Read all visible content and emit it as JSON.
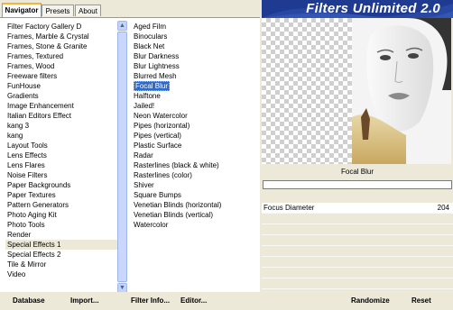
{
  "tabs": [
    {
      "label": "Navigator",
      "active": true
    },
    {
      "label": "Presets",
      "active": false
    },
    {
      "label": "About",
      "active": false
    }
  ],
  "header": {
    "title": "Filters Unlimited 2.0"
  },
  "categories": [
    "Filter Factory Gallery D",
    "Frames, Marble & Crystal",
    "Frames, Stone & Granite",
    "Frames, Textured",
    "Frames, Wood",
    "Freeware filters",
    "FunHouse",
    "Gradients",
    "Image Enhancement",
    "Italian Editors Effect",
    "kang 3",
    "kang",
    "Layout Tools",
    "Lens Effects",
    "Lens Flares",
    "Noise Filters",
    "Paper Backgrounds",
    "Paper Textures",
    "Pattern Generators",
    "Photo Aging Kit",
    "Photo Tools",
    "Render",
    "Special Effects 1",
    "Special Effects 2",
    "Tile & Mirror",
    "Video"
  ],
  "selected_category": "Special Effects 1",
  "filters": [
    "Aged Film",
    "Binoculars",
    "Black Net",
    "Blur Darkness",
    "Blur Lightness",
    "Blurred Mesh",
    "Focal Blur",
    "Halftone",
    "Jailed!",
    "Neon Watercolor",
    "Pipes (horizontal)",
    "Pipes (vertical)",
    "Plastic Surface",
    "Radar",
    "Rasterlines (black & white)",
    "Rasterlines (color)",
    "Shiver",
    "Square Bumps",
    "Venetian Blinds (horizontal)",
    "Venetian Blinds (vertical)",
    "Watercolor"
  ],
  "selected_filter": "Focal Blur",
  "preview": {
    "filter_name": "Focal Blur"
  },
  "parameter": {
    "label": "Focus Diameter",
    "value": "204"
  },
  "bottom_buttons": {
    "database": "Database",
    "import": "Import...",
    "filter_info": "Filter Info...",
    "editor": "Editor...",
    "randomize": "Randomize",
    "reset": "Reset"
  },
  "colors": {
    "header_bg": "#1e3a91",
    "selection": "#316ac5",
    "tab_highlight": "#f7b339"
  },
  "icons": {
    "scroll_up": "scroll-up-arrow-icon",
    "scroll_down": "scroll-down-arrow-icon"
  }
}
